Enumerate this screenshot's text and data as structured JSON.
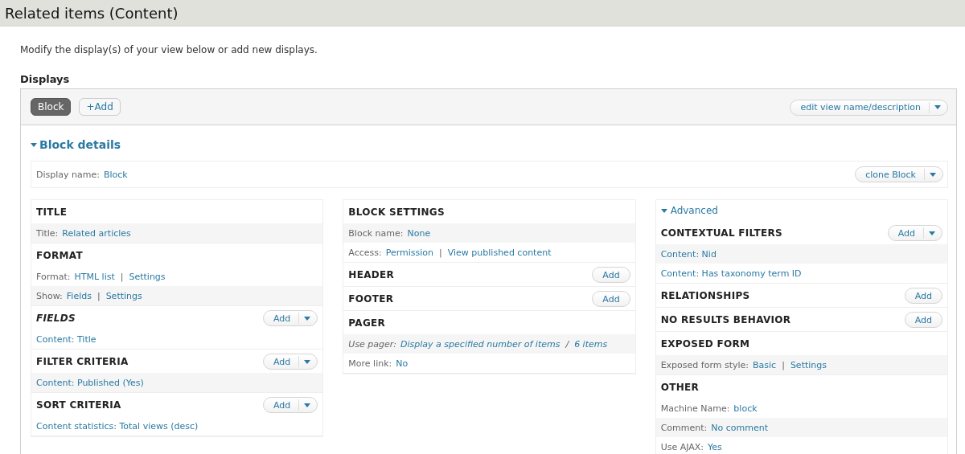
{
  "page": {
    "title": "Related items (Content)",
    "intro": "Modify the display(s) of your view below or add new displays."
  },
  "displays": {
    "heading": "Displays",
    "tabs": [
      {
        "label": "Block",
        "selected": true
      }
    ],
    "add_label": "+Add",
    "edit_button": {
      "label": "edit view name/description",
      "dropdown": true
    }
  },
  "details": {
    "toggle": "Block details",
    "expanded": true,
    "display_name_label": "Display name:",
    "display_name": "Block",
    "clone_button": {
      "label": "clone Block",
      "dropdown": true
    }
  },
  "columns": [
    {
      "sections": [
        {
          "title": "TITLE",
          "italic": false,
          "rows": [
            {
              "label": "Title:",
              "links": [
                "Related articles"
              ]
            }
          ]
        },
        {
          "title": "FORMAT",
          "italic": false,
          "rows": [
            {
              "label": "Format:",
              "links": [
                "HTML list",
                "Settings"
              ],
              "separator": "|"
            },
            {
              "label": "Show:",
              "links": [
                "Fields",
                "Settings"
              ],
              "separator": "|"
            }
          ]
        },
        {
          "title": "FIELDS",
          "italic": true,
          "add": {
            "label": "Add",
            "dropdown": true
          },
          "rows": [
            {
              "links": [
                "Content: Title"
              ]
            }
          ]
        },
        {
          "title": "FILTER CRITERIA",
          "italic": false,
          "add": {
            "label": "Add",
            "dropdown": true
          },
          "rows": [
            {
              "links": [
                "Content: Published (Yes)"
              ]
            }
          ]
        },
        {
          "title": "SORT CRITERIA",
          "italic": false,
          "add": {
            "label": "Add",
            "dropdown": true
          },
          "rows": [
            {
              "links": [
                "Content statistics: Total views (desc)"
              ]
            }
          ]
        }
      ]
    },
    {
      "sections": [
        {
          "title": "BLOCK SETTINGS",
          "italic": false,
          "rows": [
            {
              "label": "Block name:",
              "links": [
                "None"
              ],
              "italic": false
            },
            {
              "label": "Access:",
              "links": [
                "Permission",
                "View published content"
              ],
              "separator": "|",
              "italic": false
            }
          ]
        },
        {
          "title": "HEADER",
          "italic": false,
          "add": {
            "label": "Add",
            "dropdown": false
          }
        },
        {
          "title": "FOOTER",
          "italic": false,
          "add": {
            "label": "Add",
            "dropdown": false
          }
        },
        {
          "title": "PAGER",
          "italic": false,
          "rows": [
            {
              "label": "Use pager:",
              "links": [
                "Display a specified number of items",
                "6 items"
              ],
              "separator": "/",
              "italic": true
            },
            {
              "label": "More link:",
              "links": [
                "No"
              ],
              "italic": false
            }
          ]
        }
      ]
    },
    {
      "toggle": {
        "label": "Advanced",
        "expanded": true
      },
      "sections": [
        {
          "title": "CONTEXTUAL FILTERS",
          "italic": false,
          "add": {
            "label": "Add",
            "dropdown": true
          },
          "rows": [
            {
              "links": [
                "Content: Nid"
              ]
            },
            {
              "links": [
                "Content: Has taxonomy term ID"
              ]
            }
          ]
        },
        {
          "title": "RELATIONSHIPS",
          "italic": false,
          "add": {
            "label": "Add",
            "dropdown": false
          }
        },
        {
          "title": "NO RESULTS BEHAVIOR",
          "italic": false,
          "add": {
            "label": "Add",
            "dropdown": false
          }
        },
        {
          "title": "EXPOSED FORM",
          "italic": false,
          "rows": [
            {
              "label": "Exposed form style:",
              "links": [
                "Basic",
                "Settings"
              ],
              "separator": "|"
            }
          ]
        },
        {
          "title": "OTHER",
          "italic": false,
          "rows": [
            {
              "label": "Machine Name:",
              "links": [
                "block"
              ]
            },
            {
              "label": "Comment:",
              "links": [
                "No comment"
              ]
            },
            {
              "label": "Use AJAX:",
              "links": [
                "Yes"
              ]
            }
          ]
        }
      ]
    }
  ]
}
